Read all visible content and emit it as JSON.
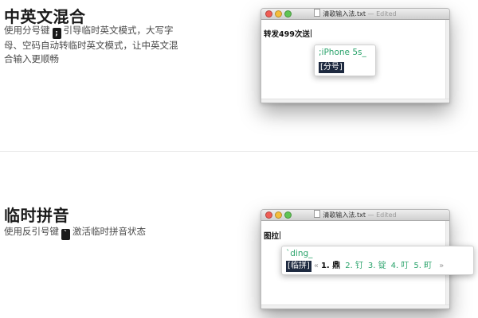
{
  "section1": {
    "title": "中英文混合",
    "desc_line1_a": "使用分号键",
    "desc_key": ";",
    "desc_line1_b": "引导临时英文模式，大写字",
    "desc_line2": "母、空码自动转临时英文模式，让中英文混",
    "desc_line3": "合输入更顺畅",
    "window": {
      "filename": "清歌输入法.txt",
      "status": "— Edited",
      "text": "转发499次送"
    },
    "candidate": {
      "composition": ";iPhone 5s_",
      "tag": "[分号]"
    }
  },
  "section2": {
    "title": "临时拼音",
    "desc_a": "使用反引号键",
    "desc_key": "`",
    "desc_b": "激活临时拼音状态",
    "window": {
      "filename": "清歌输入法.txt",
      "status": "— Edited",
      "text": "图拉"
    },
    "candidate": {
      "composition": "`ding_",
      "tag": "[临拼]",
      "prev": "«",
      "next": "»",
      "items": [
        "1. 鼎",
        "2. 钉",
        "3. 锭",
        "4. 叮",
        "5. 町"
      ]
    }
  },
  "colors": {
    "accent_green": "#2aa36b",
    "tag_bg": "#1e2a40"
  }
}
